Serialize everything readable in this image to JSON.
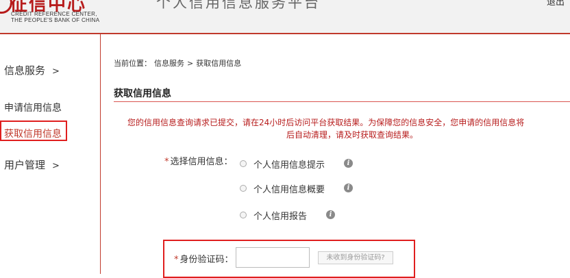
{
  "header": {
    "logo_cn": "征信中心",
    "logo_en_line1": "CREDIT REFERENCE CENTER,",
    "logo_en_line2": "THE PEOPLE'S BANK OF CHINA",
    "site_title": "个人信用信息服务平台",
    "logout": "退出"
  },
  "sidebar": {
    "group1": {
      "label": "信息服务",
      "chevron": ">"
    },
    "items": [
      {
        "label": "申请信用信息"
      },
      {
        "label": "获取信用信息",
        "active": true
      }
    ],
    "group2": {
      "label": "用户管理",
      "chevron": ">"
    }
  },
  "breadcrumb": {
    "prefix": "当前位置：",
    "level1": "信息服务",
    "separator": ">",
    "level2": "获取信用信息"
  },
  "page": {
    "title": "获取信用信息",
    "notice_line1": "您的信用信息查询请求已提交，请在24小时后访问平台获取结果。为保障您的信息安全，您申请的信用信息将",
    "notice_line2": "后自动清理，请及时获取查询结果。"
  },
  "form": {
    "required_mark": "*",
    "select_label": "选择信用信息：",
    "options": [
      {
        "label": "个人信用信息提示",
        "icon": "info-icon"
      },
      {
        "label": "个人信用信息概要",
        "icon": "info-icon"
      },
      {
        "label": "个人信用报告",
        "icon": "info-icon"
      }
    ],
    "id_code_label": "身份验证码：",
    "id_code_value": "",
    "id_help_button": "未收到身份验证码?"
  },
  "colors": {
    "brand_red": "#b71c1c",
    "highlight_red": "#e01e1e",
    "notice_red": "#b71c1c",
    "header_bg": "#f2f2f2"
  }
}
